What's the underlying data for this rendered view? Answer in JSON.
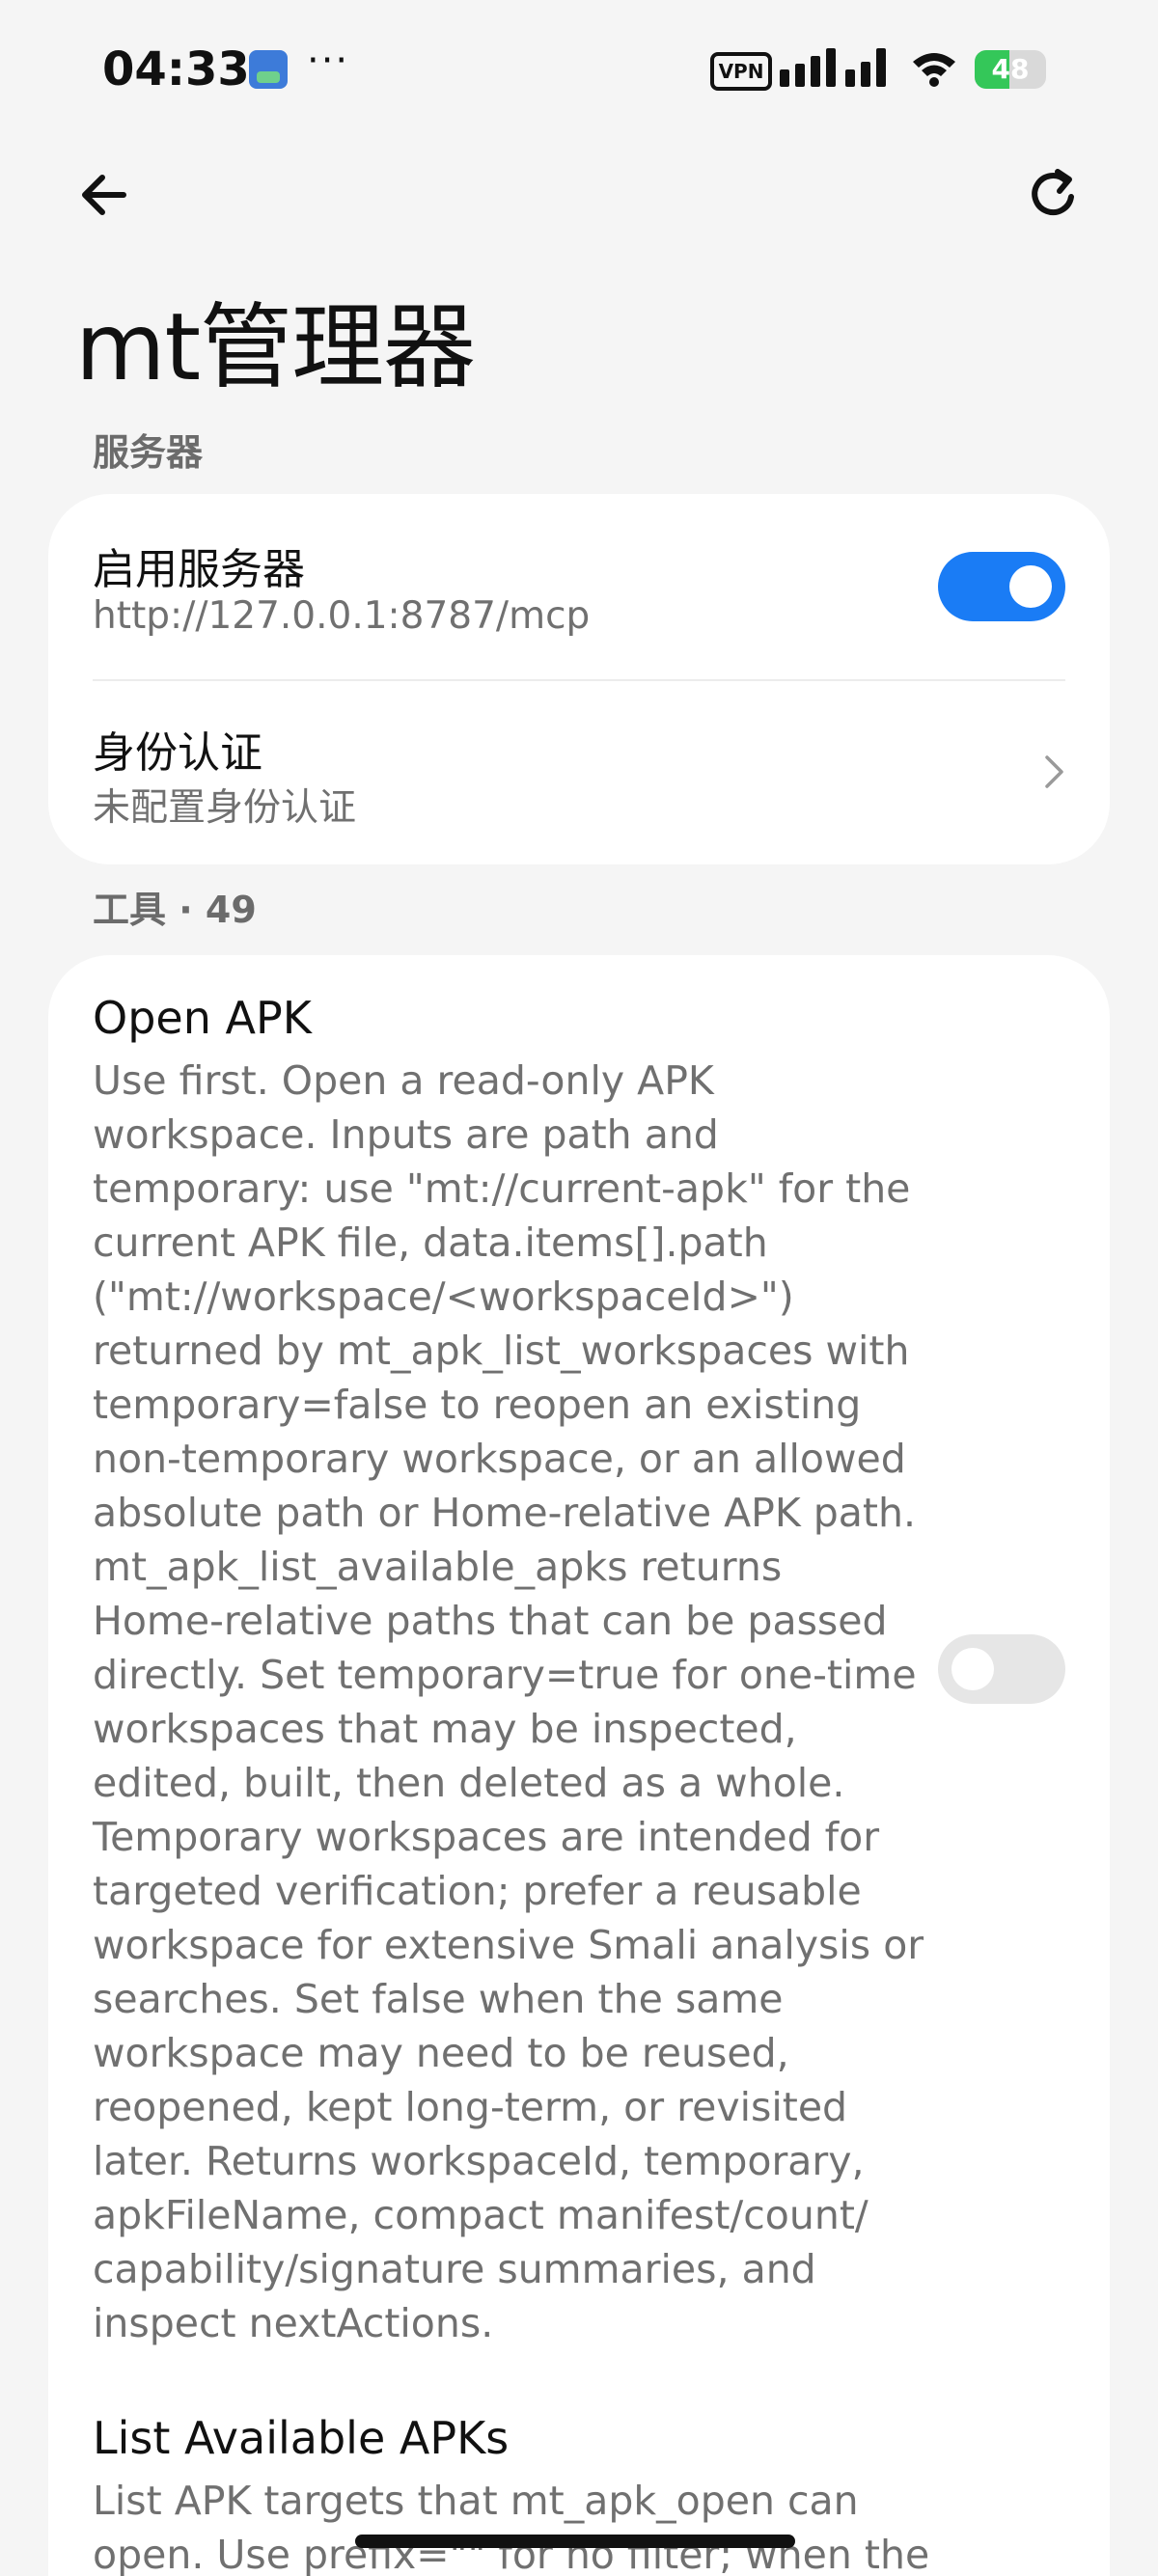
{
  "status_bar": {
    "time": "04:33",
    "dots": "···",
    "vpn_label": "VPN",
    "battery_level": 48,
    "battery_text": "48"
  },
  "header": {
    "title": "mt管理器"
  },
  "server_section": {
    "header": "服务器",
    "enable_server": {
      "title": "启用服务器",
      "url": "http://127.0.0.1:8787/mcp",
      "enabled": true
    },
    "auth": {
      "title": "身份认证",
      "subtitle": "未配置身份认证"
    }
  },
  "tools_section": {
    "header": "工具 · 49",
    "tools": [
      {
        "title": "Open APK",
        "description": "Use first. Open a read-only APK\nworkspace. Inputs are path and\ntemporary: use \"mt://current-apk\" for the\ncurrent APK file, data.items[].path\n(\"mt://workspace/<workspaceId>\")\nreturned by mt_apk_list_workspaces with\ntemporary=false to reopen an existing\nnon-temporary workspace, or an allowed\nabsolute path or Home-relative APK path.\nmt_apk_list_available_apks returns\nHome-relative paths that can be passed\ndirectly. Set temporary=true for one-time\nworkspaces that may be inspected,\nedited, built, then deleted as a whole.\nTemporary workspaces are intended for\ntargeted verification; prefer a reusable\nworkspace for extensive Smali analysis or\nsearches. Set false when the same\nworkspace may need to be reused,\nreopened, kept long-term, or revisited\nlater. Returns workspaceId, temporary,\napkFileName, compact manifest/count/\ncapability/signature summaries, and\ninspect nextActions.",
        "enabled": false
      },
      {
        "title": "List Available APKs",
        "description": "List APK targets that mt_apk_open can\nopen. Use prefix=\"\" for no filter; when the"
      }
    ]
  },
  "colors": {
    "accent": "#1a7cf5",
    "background": "#f5f5f5",
    "card": "#ffffff",
    "secondary_text": "#707070",
    "section_text": "#6b6b6b"
  }
}
